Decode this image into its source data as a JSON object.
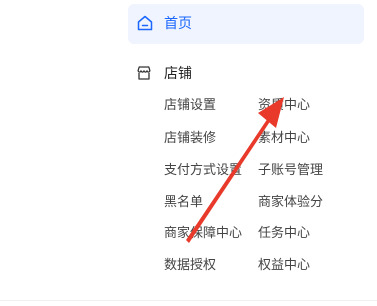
{
  "colors": {
    "accent": "#1a66ff",
    "selected_bg": "#eff4fe",
    "arrow": "#e8392b"
  },
  "nav": {
    "home": {
      "icon": "home-icon",
      "label": "首页"
    },
    "store": {
      "icon": "store-icon",
      "label": "店铺",
      "items": [
        "店铺设置",
        "资质中心",
        "店铺装修",
        "素材中心",
        "支付方式设置",
        "子账号管理",
        "黑名单",
        "商家体验分",
        "商家保障中心",
        "任务中心",
        "数据授权",
        "权益中心"
      ]
    }
  }
}
